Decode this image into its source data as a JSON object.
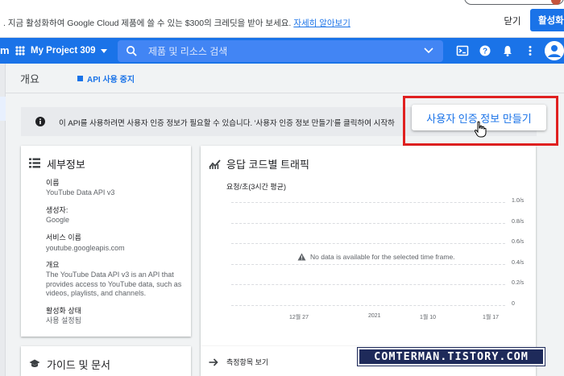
{
  "promo": {
    "text": ". 지금 활성화하여 Google Cloud 제품에 쓸 수 있는 $300의 크레딧을 받아 보세요.",
    "link": "자세히 알아보기",
    "close": "닫기",
    "activate": "활성화"
  },
  "topbar": {
    "menu_glyph": "m",
    "project": "My Project 309",
    "search_placeholder": "제품 및 리소스 검색",
    "icons": [
      "cloud-shell-icon",
      "help-icon",
      "notifications-icon",
      "more-vert-icon",
      "account-icon"
    ]
  },
  "header": {
    "title": "개요",
    "stop_api": "API 사용 중지"
  },
  "info": {
    "text": "이 API를 사용하려면 사용자 인증 정보가 필요할 수 있습니다. '사용자 인증 정보 만들기'를 클릭하여 시작하",
    "create_credentials": "사용자 인증 정보 만들기"
  },
  "details": {
    "title": "세부정보",
    "fields": [
      {
        "label": "이름",
        "value": "YouTube Data API v3"
      },
      {
        "label": "생성자:",
        "value": "Google"
      },
      {
        "label": "서비스 이름",
        "value": "youtube.googleapis.com"
      },
      {
        "label": "개요",
        "value": "The YouTube Data API v3 is an API that provides access to YouTube data, such as videos, playlists, and channels."
      },
      {
        "label": "활성화 상태",
        "value": "사용 설정됨"
      }
    ]
  },
  "traffic": {
    "title": "응답 코드별 트래픽",
    "subtitle": "요청/초(3시간 평균)",
    "no_data": "No data is available for the selected time frame.",
    "metrics_link": "측정항목 보기"
  },
  "chart_data": {
    "type": "line",
    "title": "응답 코드별 트래픽",
    "ylabel": "요청/초(3시간 평균)",
    "x_ticks": [
      "12월 27",
      "2021",
      "1월 10",
      "1월 17"
    ],
    "y_ticks": [
      "1.0/s",
      "0.8/s",
      "0.6/s",
      "0.4/s",
      "0.2/s",
      "0"
    ],
    "ylim": [
      0,
      1.0
    ],
    "series": [],
    "grid": true
  },
  "guides": {
    "title": "가이드 및 문서"
  },
  "watermark": "COMTERMAN.TISTORY.COM"
}
